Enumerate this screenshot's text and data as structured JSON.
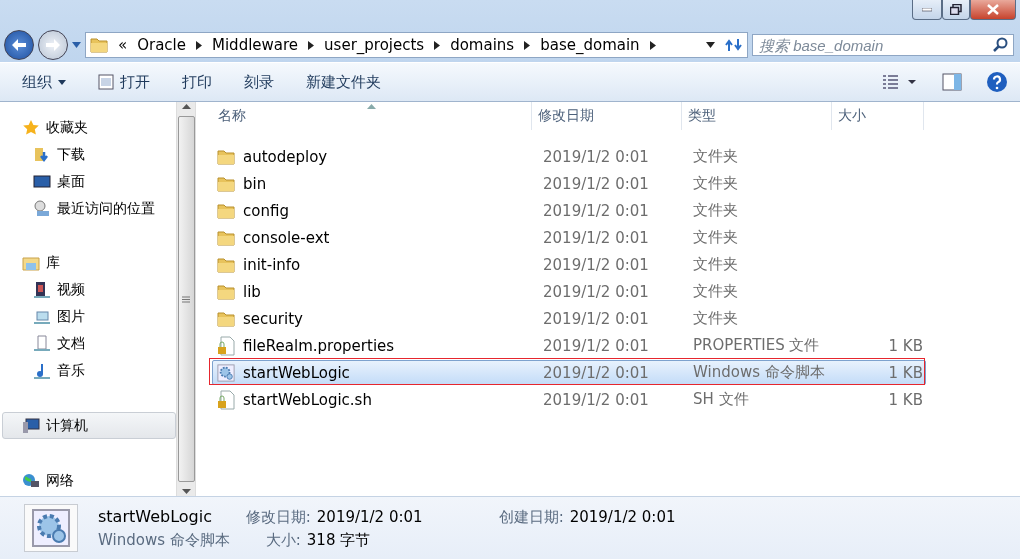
{
  "breadcrumb": {
    "overflow": "«",
    "parts": [
      "Oracle",
      "Middleware",
      "user_projects",
      "domains",
      "base_domain"
    ]
  },
  "search": {
    "placeholder": "搜索 base_domain"
  },
  "toolbar": {
    "organize": "组织",
    "buttons": [
      "打开",
      "打印",
      "刻录",
      "新建文件夹"
    ]
  },
  "sidebar": {
    "groups": [
      {
        "label": "收藏夹",
        "kind": "favorites",
        "selected": false,
        "children": [
          {
            "label": "下载",
            "kind": "download"
          },
          {
            "label": "桌面",
            "kind": "desktop"
          },
          {
            "label": "最近访问的位置",
            "kind": "recent"
          }
        ]
      },
      {
        "label": "库",
        "kind": "library",
        "selected": false,
        "children": [
          {
            "label": "视频",
            "kind": "video"
          },
          {
            "label": "图片",
            "kind": "image"
          },
          {
            "label": "文档",
            "kind": "document"
          },
          {
            "label": "音乐",
            "kind": "music"
          }
        ]
      },
      {
        "label": "计算机",
        "kind": "computer",
        "selected": true
      },
      {
        "label": "网络",
        "kind": "network",
        "selected": false
      }
    ]
  },
  "table": {
    "columns": [
      "名称",
      "修改日期",
      "类型",
      "大小"
    ],
    "rows": [
      {
        "kind": "folder",
        "name": "autodeploy",
        "date": "2019/1/2 0:01",
        "type": "文件夹",
        "size": "",
        "selected": false
      },
      {
        "kind": "folder",
        "name": "bin",
        "date": "2019/1/2 0:01",
        "type": "文件夹",
        "size": "",
        "selected": false
      },
      {
        "kind": "folder",
        "name": "config",
        "date": "2019/1/2 0:01",
        "type": "文件夹",
        "size": "",
        "selected": false
      },
      {
        "kind": "folder",
        "name": "console-ext",
        "date": "2019/1/2 0:01",
        "type": "文件夹",
        "size": "",
        "selected": false
      },
      {
        "kind": "folder",
        "name": "init-info",
        "date": "2019/1/2 0:01",
        "type": "文件夹",
        "size": "",
        "selected": false
      },
      {
        "kind": "folder",
        "name": "lib",
        "date": "2019/1/2 0:01",
        "type": "文件夹",
        "size": "",
        "selected": false
      },
      {
        "kind": "folder",
        "name": "security",
        "date": "2019/1/2 0:01",
        "type": "文件夹",
        "size": "",
        "selected": false
      },
      {
        "kind": "file",
        "name": "fileRealm.properties",
        "date": "2019/1/2 0:01",
        "type": "PROPERTIES 文件",
        "size": "1 KB",
        "selected": false
      },
      {
        "kind": "script",
        "name": "startWebLogic",
        "date": "2019/1/2 0:01",
        "type": "Windows 命令脚本",
        "size": "1 KB",
        "selected": true
      },
      {
        "kind": "file",
        "name": "startWebLogic.sh",
        "date": "2019/1/2 0:01",
        "type": "SH 文件",
        "size": "1 KB",
        "selected": false
      }
    ]
  },
  "details": {
    "name": "startWebLogic",
    "type": "Windows 命令脚本",
    "fields": [
      {
        "label": "修改日期:",
        "value": "2019/1/2 0:01"
      },
      {
        "label": "大小:",
        "value": "318 字节"
      },
      {
        "label": "创建日期:",
        "value": "2019/1/2 0:01"
      }
    ]
  }
}
